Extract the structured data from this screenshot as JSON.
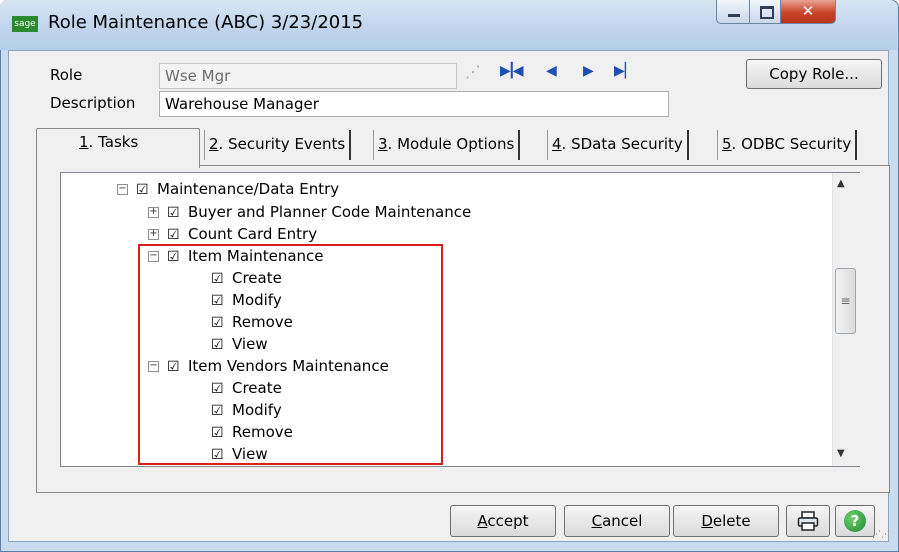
{
  "window": {
    "title": "Role Maintenance (ABC) 3/23/2015",
    "logo_text": "sage"
  },
  "form": {
    "role_label": "Role",
    "role_value": "Wse Mgr",
    "description_label": "Description",
    "description_value": "Warehouse Manager",
    "copy_role_button": "Copy Role..."
  },
  "tabs": [
    {
      "num": "1",
      "label": ". Tasks"
    },
    {
      "num": "2",
      "label": ". Security Events"
    },
    {
      "num": "3",
      "label": ". Module Options"
    },
    {
      "num": "4",
      "label": ". SData Security"
    },
    {
      "num": "5",
      "label": ". ODBC Security"
    }
  ],
  "tree": {
    "root": "Maintenance/Data Entry",
    "items": [
      "Buyer and Planner Code Maintenance",
      "Count Card Entry",
      "Item Maintenance",
      "Create",
      "Modify",
      "Remove",
      "View",
      "Item Vendors Maintenance",
      "Create",
      "Modify",
      "Remove",
      "View"
    ]
  },
  "buttons": {
    "accept": {
      "u": "A",
      "rest": "ccept"
    },
    "cancel": {
      "u": "C",
      "rest": "ancel"
    },
    "delete": {
      "u": "D",
      "rest": "elete"
    },
    "help": "?"
  },
  "icons": {
    "print": "printer-icon",
    "help": "help-icon",
    "nav_first": "first-record-icon",
    "nav_prev": "previous-record-icon",
    "nav_next": "next-record-icon",
    "nav_last": "last-record-icon"
  },
  "colors": {
    "highlight_border": "#d8201d",
    "close_button": "#c8432a",
    "nav_arrows": "#1e50b4"
  }
}
